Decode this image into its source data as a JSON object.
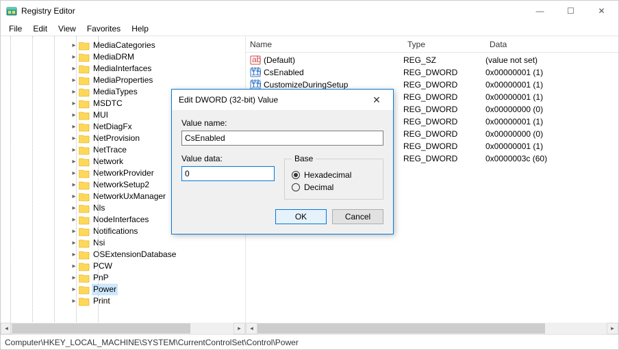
{
  "window": {
    "title": "Registry Editor",
    "buttons": {
      "min": "—",
      "max": "☐",
      "close": "✕"
    }
  },
  "menu": [
    "File",
    "Edit",
    "View",
    "Favorites",
    "Help"
  ],
  "tree": {
    "nodes": [
      "MediaCategories",
      "MediaDRM",
      "MediaInterfaces",
      "MediaProperties",
      "MediaTypes",
      "MSDTC",
      "MUI",
      "NetDiagFx",
      "NetProvision",
      "NetTrace",
      "Network",
      "NetworkProvider",
      "NetworkSetup2",
      "NetworkUxManager",
      "Nls",
      "NodeInterfaces",
      "Notifications",
      "Nsi",
      "OSExtensionDatabase",
      "PCW",
      "PnP",
      "Power",
      "Print"
    ],
    "selected": "Power"
  },
  "list": {
    "headers": {
      "name": "Name",
      "type": "Type",
      "data": "Data"
    },
    "col_widths": {
      "name": 230,
      "type": 120,
      "data": 180
    },
    "rows": [
      {
        "icon": "str",
        "name": "(Default)",
        "type": "REG_SZ",
        "data": "(value not set)"
      },
      {
        "icon": "bin",
        "name": "CsEnabled",
        "type": "REG_DWORD",
        "data": "0x00000001 (1)"
      },
      {
        "icon": "bin",
        "name": "CustomizeDuringSetup",
        "type": "REG_DWORD",
        "data": "0x00000001 (1)"
      },
      {
        "icon": "bin",
        "name": "",
        "type": "REG_DWORD",
        "data": "0x00000001 (1)"
      },
      {
        "icon": "bin",
        "name": "",
        "type": "REG_DWORD",
        "data": "0x00000000 (0)"
      },
      {
        "icon": "bin",
        "name": "",
        "type": "REG_DWORD",
        "data": "0x00000001 (1)"
      },
      {
        "icon": "bin",
        "name": "",
        "type": "REG_DWORD",
        "data": "0x00000000 (0)"
      },
      {
        "icon": "bin",
        "name": "",
        "type": "REG_DWORD",
        "data": "0x00000001 (1)"
      },
      {
        "icon": "bin",
        "name": "",
        "type": "REG_DWORD",
        "data": "0x0000003c (60)"
      }
    ]
  },
  "dialog": {
    "title": "Edit DWORD (32-bit) Value",
    "value_name_label": "Value name:",
    "value_name": "CsEnabled",
    "value_data_label": "Value data:",
    "value_data": "0",
    "base_label": "Base",
    "hex_label": "Hexadecimal",
    "dec_label": "Decimal",
    "base_selected": "hex",
    "ok": "OK",
    "cancel": "Cancel",
    "close": "✕"
  },
  "status": "Computer\\HKEY_LOCAL_MACHINE\\SYSTEM\\CurrentControlSet\\Control\\Power"
}
